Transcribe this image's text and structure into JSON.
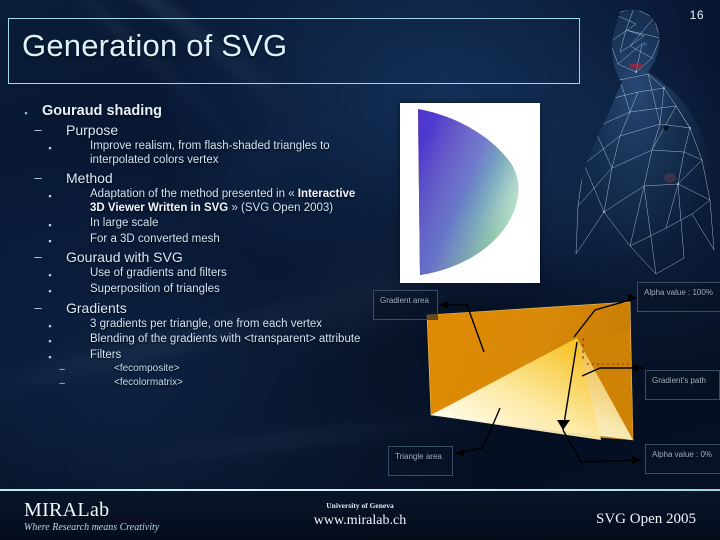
{
  "slide": {
    "number": "16",
    "title": "Generation of SVG"
  },
  "outline": {
    "l1_gouraud_shading": "Gouraud shading",
    "l2_purpose": "Purpose",
    "l3_improve_realism": "Improve realism, from flash-shaded triangles to interpolated colors vertex",
    "l2_method": "Method",
    "l3_adaptation_pre": "Adaptation of the method presented in « ",
    "l3_adaptation_bold": "Interactive 3D Viewer Written in SVG",
    "l3_adaptation_post": " » (SVG Open 2003)",
    "l3_large_scale": "In large scale",
    "l3_converted_mesh": "For a 3D converted mesh",
    "l2_gouraud_with_svg": "Gouraud with SVG",
    "l3_use_gradients": "Use of gradients and filters",
    "l3_superposition": "Superposition of triangles",
    "l2_gradients": "Gradients",
    "l3_three_gradients": "3 gradients per triangle, one from each vertex",
    "l3_blending": "Blending of the gradients with <transparent> attribute",
    "l3_filters": "Filters",
    "l4_fecomposite": "<fecomposite>",
    "l4_fecolormatrix": "<fecolormatrix>"
  },
  "markers": {
    "level1": "▪",
    "level2": "–",
    "level3": "▪",
    "level4": "–"
  },
  "figures": {
    "gouraud_triangle_caption": "gouraud-shaded-triangle-fan",
    "wireframe_caption": "wireframe-mesh-human-figure"
  },
  "diagram": {
    "label_gradient_area": "Gradient area",
    "label_alpha_100": "Alpha value : 100%",
    "label_gradient_path": "Gradient's path",
    "label_triangle_area": "Triangle area",
    "label_alpha_0": "Alpha value : 0%"
  },
  "footer": {
    "brand": "MIRALab",
    "tagline": "Where Research means Creativity",
    "university": "University of Geneva",
    "url": "www.miralab.ch",
    "event": "SVG Open 2005"
  },
  "colors": {
    "title_text": "#d9f3fb",
    "title_border": "#9fd9e6",
    "body_text": "#d8e9f7",
    "background_deep": "#071530",
    "footer_rule": "#cfeff2",
    "diagram_orange": "#d98a08",
    "diagram_light": "#fff6d2"
  }
}
